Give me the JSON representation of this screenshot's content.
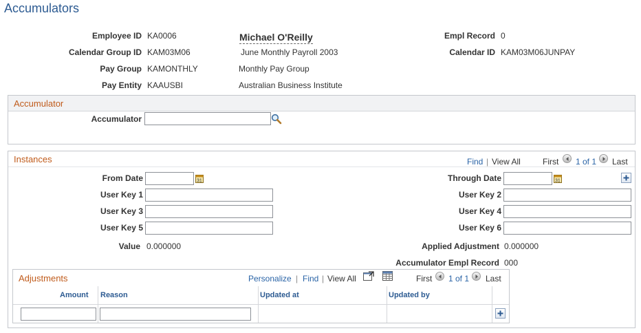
{
  "page": {
    "title": "Accumulators"
  },
  "header": {
    "employee_id_label": "Employee ID",
    "employee_id": "KA0006",
    "employee_name": "Michael O'Reilly",
    "empl_record_label": "Empl Record",
    "empl_record": "0",
    "calendar_group_label": "Calendar Group ID",
    "calendar_group_id": "KAM03M06",
    "calendar_group_desc": "June Monthly Payroll 2003",
    "calendar_id_label": "Calendar ID",
    "calendar_id": "KAM03M06JUNPAY",
    "pay_group_label": "Pay Group",
    "pay_group": "KAMONTHLY",
    "pay_group_desc": "Monthly Pay Group",
    "pay_entity_label": "Pay Entity",
    "pay_entity": "KAAUSBI",
    "pay_entity_desc": "Australian Business Institute"
  },
  "accumulator_section": {
    "title": "Accumulator",
    "field_label": "Accumulator",
    "field_value": "",
    "icon": "search-icon"
  },
  "instances": {
    "title": "Instances",
    "nav": {
      "find": "Find",
      "separator": "|",
      "view_all": "View All",
      "first": "First",
      "range": "1 of 1",
      "last": "Last"
    },
    "from_date_label": "From Date",
    "from_date": "",
    "through_date_label": "Through Date",
    "through_date": "",
    "user_key_1_label": "User Key 1",
    "user_key_1": "",
    "user_key_2_label": "User Key 2",
    "user_key_2": "",
    "user_key_3_label": "User Key 3",
    "user_key_3": "",
    "user_key_4_label": "User Key 4",
    "user_key_4": "",
    "user_key_5_label": "User Key 5",
    "user_key_5": "",
    "user_key_6_label": "User Key 6",
    "user_key_6": "",
    "value_label": "Value",
    "value": "0.000000",
    "applied_adjustment_label": "Applied Adjustment",
    "applied_adjustment": "0.000000",
    "accum_empl_record_label": "Accumulator Empl Record",
    "accum_empl_record": "000"
  },
  "adjustments": {
    "title": "Adjustments",
    "nav": {
      "personalize": "Personalize",
      "separator": "|",
      "find": "Find",
      "view_all": "View All",
      "first": "First",
      "range": "1 of 1",
      "last": "Last"
    },
    "columns": [
      "Amount",
      "Reason",
      "Updated at",
      "Updated by"
    ],
    "rows": [
      {
        "amount": "",
        "reason": "",
        "updated_at": "",
        "updated_by": ""
      }
    ]
  },
  "colors": {
    "title_blue": "#2d5b92",
    "section_orange": "#c05b1b",
    "link_blue": "#2963a6"
  }
}
